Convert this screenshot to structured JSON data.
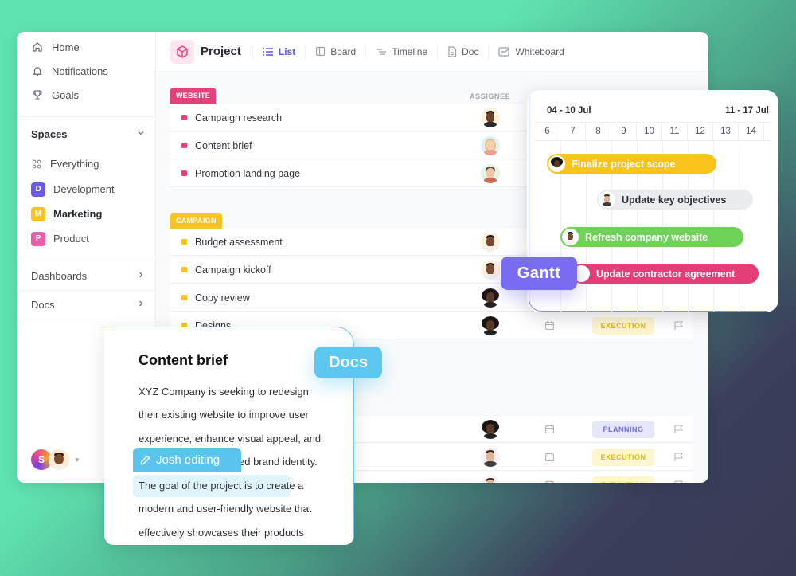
{
  "sidebar": {
    "nav": [
      {
        "label": "Home",
        "icon": "home-icon"
      },
      {
        "label": "Notifications",
        "icon": "bell-icon"
      },
      {
        "label": "Goals",
        "icon": "trophy-icon"
      }
    ],
    "spaces_title": "Spaces",
    "everything_label": "Everything",
    "spaces": [
      {
        "letter": "D",
        "label": "Development",
        "color": "#6b5ce7",
        "active": false
      },
      {
        "letter": "M",
        "label": "Marketing",
        "color": "#f7c325",
        "active": true
      },
      {
        "letter": "P",
        "label": "Product",
        "color": "#ef5da8",
        "active": false
      }
    ],
    "dashboards_label": "Dashboards",
    "docs_label": "Docs",
    "user_initial": "S"
  },
  "topbar": {
    "project_title": "Project",
    "tabs": [
      {
        "label": "List",
        "icon": "list-icon",
        "active": true
      },
      {
        "label": "Board",
        "icon": "board-icon",
        "active": false
      },
      {
        "label": "Timeline",
        "icon": "timeline-icon",
        "active": false
      },
      {
        "label": "Doc",
        "icon": "doc-icon",
        "active": false
      },
      {
        "label": "Whiteboard",
        "icon": "whiteboard-icon",
        "active": false
      }
    ]
  },
  "list": {
    "assignee_header": "ASSIGNEE",
    "groups": [
      {
        "label": "WEBSITE",
        "color": "#e5407a",
        "tasks": [
          "Campaign research",
          "Content brief",
          "Promotion landing page"
        ]
      },
      {
        "label": "CAMPAIGN",
        "color": "#f7c325",
        "tasks": [
          "Budget assessment",
          "Campaign kickoff",
          "Copy review",
          "Designs"
        ]
      }
    ],
    "statuses": {
      "designs": "EXECUTION",
      "row1": "PLANNING",
      "row2": "EXECUTION",
      "row3": "EXECUTION"
    }
  },
  "gantt": {
    "tag": "Gantt",
    "week1": "04 - 10 Jul",
    "week2": "11 - 17 Jul",
    "days": [
      "6",
      "7",
      "8",
      "9",
      "10",
      "11",
      "12",
      "13",
      "14"
    ],
    "bars": [
      {
        "label": "Finalize project scope",
        "color": "#f8c41a",
        "text_color": "#ffffff"
      },
      {
        "label": "Update key objectives",
        "color": "#ebecf0",
        "text_color": "#292d34"
      },
      {
        "label": "Refresh company website",
        "color": "#6fd35a",
        "text_color": "#ffffff"
      },
      {
        "label": "Update contractor agreement",
        "color": "#e53d77",
        "text_color": "#ffffff"
      }
    ]
  },
  "docs": {
    "tag": "Docs",
    "title": "Content brief",
    "lines": [
      "XYZ Company is seeking to redesign",
      "their existing website to improve user",
      "experience, enhance visual appeal, and",
      "ed brand identity.",
      "The goal of the project is to create a",
      "modern and user-friendly website that",
      "effectively showcases their products"
    ],
    "editor_label": "Josh editing"
  }
}
